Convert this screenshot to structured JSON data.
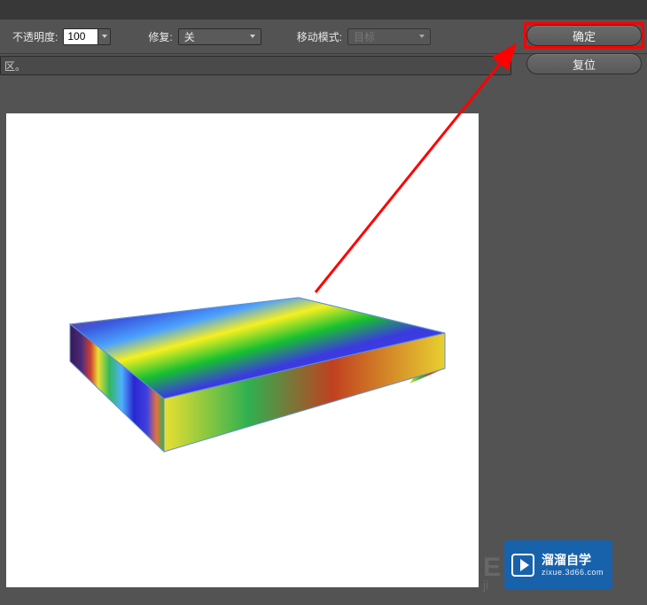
{
  "toolbar": {
    "opacity_label": "不透明度:",
    "opacity_value": "100",
    "repair_label": "修复:",
    "repair_value": "关",
    "move_mode_label": "移动模式:",
    "move_mode_value": "目标"
  },
  "buttons": {
    "confirm": "确定",
    "reset": "复位"
  },
  "description": "区。",
  "watermark": {
    "title": "溜溜自学",
    "sub": "zixue.3d66.com"
  },
  "bg_logo": {
    "line1": "E",
    "line2": "ji"
  }
}
